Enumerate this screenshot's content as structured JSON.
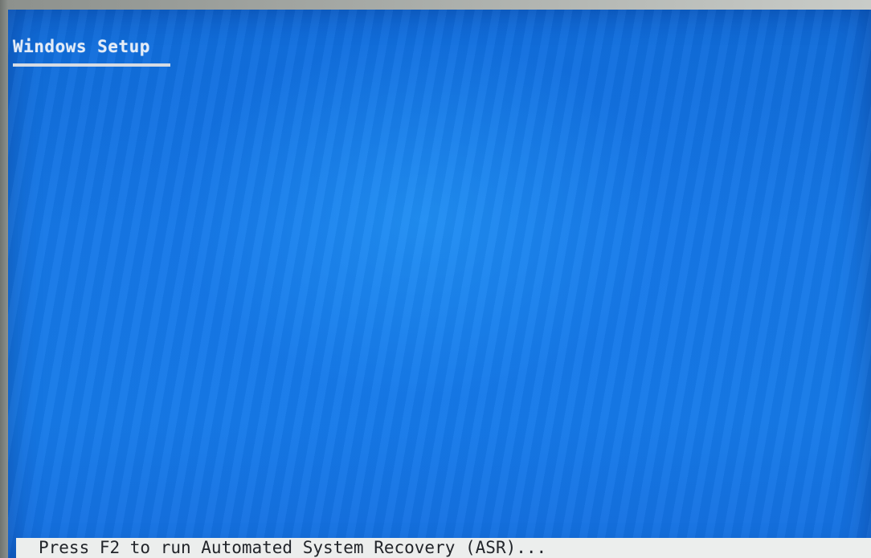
{
  "setup": {
    "title": "Windows Setup"
  },
  "status_bar": {
    "text": "Press F2 to run Automated System Recovery (ASR)..."
  },
  "colors": {
    "screen_background": "#1678e6",
    "title_text": "#e4ecf7",
    "status_bar_background": "#eceeed",
    "status_bar_text": "#22252a"
  }
}
